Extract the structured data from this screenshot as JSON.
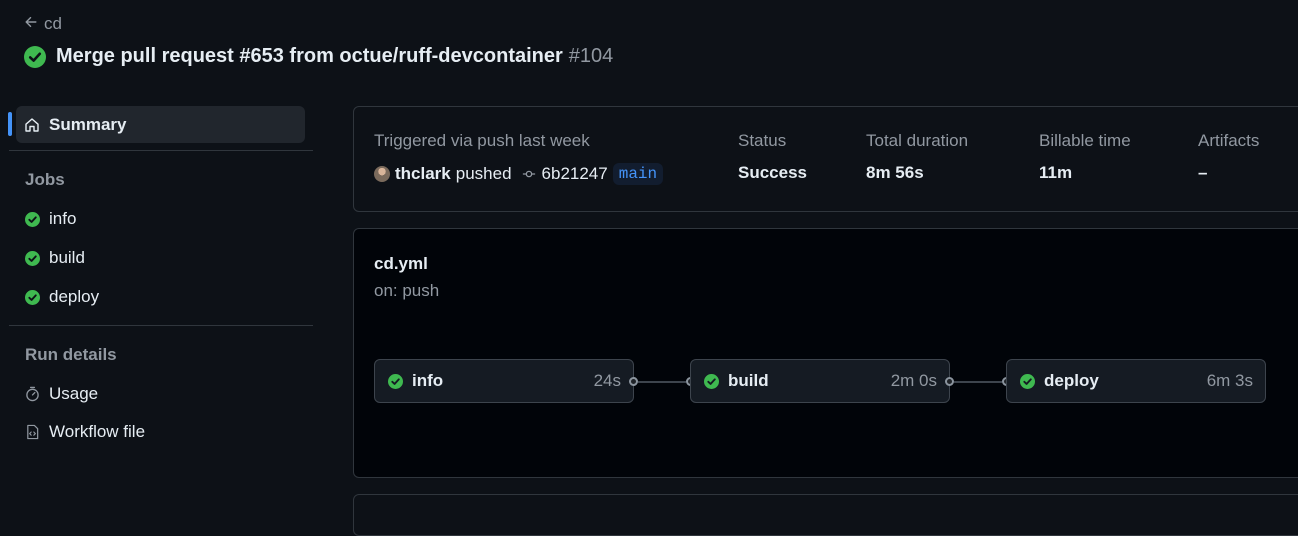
{
  "header": {
    "back_label": "cd",
    "title": "Merge pull request #653 from octue/ruff-devcontainer",
    "run_number": "#104"
  },
  "sidebar": {
    "summary_label": "Summary",
    "jobs_heading": "Jobs",
    "jobs": [
      {
        "label": "info",
        "status": "success"
      },
      {
        "label": "build",
        "status": "success"
      },
      {
        "label": "deploy",
        "status": "success"
      }
    ],
    "run_details_heading": "Run details",
    "run_details": [
      {
        "label": "Usage",
        "icon": "stopwatch-icon"
      },
      {
        "label": "Workflow file",
        "icon": "file-code-icon"
      }
    ]
  },
  "summary": {
    "trigger_label": "Triggered via push last week",
    "actor": "thclark",
    "action": "pushed",
    "commit": "6b21247",
    "branch": "main",
    "status_label": "Status",
    "status_value": "Success",
    "duration_label": "Total duration",
    "duration_value": "8m 56s",
    "billable_label": "Billable time",
    "billable_value": "11m",
    "artifacts_label": "Artifacts",
    "artifacts_value": "–"
  },
  "workflow": {
    "file": "cd.yml",
    "trigger": "on: push",
    "jobs": [
      {
        "name": "info",
        "duration": "24s"
      },
      {
        "name": "build",
        "duration": "2m 0s"
      },
      {
        "name": "deploy",
        "duration": "6m 3s"
      }
    ]
  },
  "colors": {
    "success": "#3fb950",
    "accent": "#4493f8",
    "background": "#0d1117"
  }
}
